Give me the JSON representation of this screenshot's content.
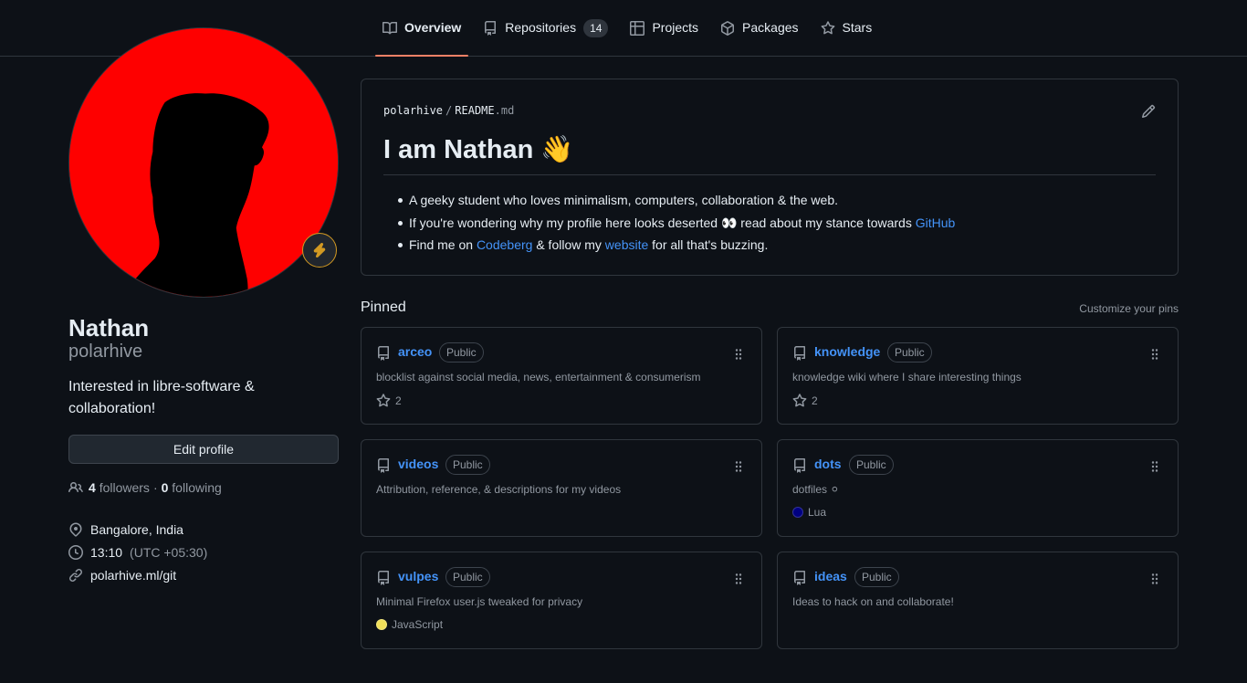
{
  "tabs": [
    {
      "label": "Overview",
      "icon": "book-icon",
      "active": true
    },
    {
      "label": "Repositories",
      "icon": "repo-icon",
      "count": "14"
    },
    {
      "label": "Projects",
      "icon": "table-icon"
    },
    {
      "label": "Packages",
      "icon": "package-icon"
    },
    {
      "label": "Stars",
      "icon": "star-icon"
    }
  ],
  "profile": {
    "name": "Nathan",
    "login": "polarhive",
    "bio": "Interested in libre-software & collaboration!",
    "edit_label": "Edit profile",
    "followers_count": "4",
    "followers_label": "followers",
    "separator": "·",
    "following_count": "0",
    "following_label": "following",
    "location": "Bangalore, India",
    "time": "13:10",
    "timezone": "(UTC +05:30)",
    "website": "polarhive.ml/git",
    "status_icon": "lightning-icon"
  },
  "readme": {
    "owner": "polarhive",
    "slash": "/",
    "file_base": "README",
    "file_ext": ".md",
    "heading": "I am Nathan 👋",
    "line1": "A geeky student who loves minimalism, computers, collaboration & the web.",
    "line2_prefix": "If you're wondering why my profile here looks deserted 👀 read about my stance towards ",
    "line2_link": "GitHub",
    "line3_prefix": "Find me on ",
    "line3_link1": "Codeberg",
    "line3_mid": " & follow my ",
    "line3_link2": "website",
    "line3_suffix": " for all that's buzzing."
  },
  "pinned": {
    "title": "Pinned",
    "customize_label": "Customize your pins",
    "repos": [
      {
        "name": "arceo",
        "visibility": "Public",
        "description": "blocklist against social media, news, entertainment & consumerism",
        "stars": "2"
      },
      {
        "name": "knowledge",
        "visibility": "Public",
        "description": "knowledge wiki where I share interesting things",
        "stars": "2"
      },
      {
        "name": "videos",
        "visibility": "Public",
        "description": "Attribution, reference, & descriptions for my videos"
      },
      {
        "name": "dots",
        "visibility": "Public",
        "description": "dotfiles ⚪",
        "language": "Lua",
        "language_color": "#000080"
      },
      {
        "name": "vulpes",
        "visibility": "Public",
        "description": "Minimal Firefox user.js tweaked for privacy",
        "language": "JavaScript",
        "language_color": "#f1e05a"
      },
      {
        "name": "ideas",
        "visibility": "Public",
        "description": "Ideas to hack on and collaborate!"
      }
    ]
  },
  "colors": {
    "background": "#0d1117",
    "border": "#30363d",
    "link": "#4493f8",
    "muted": "#9198a1",
    "tab_underline": "#f78166",
    "avatar_bg": "#fe0000",
    "status_ring": "#d29922"
  }
}
